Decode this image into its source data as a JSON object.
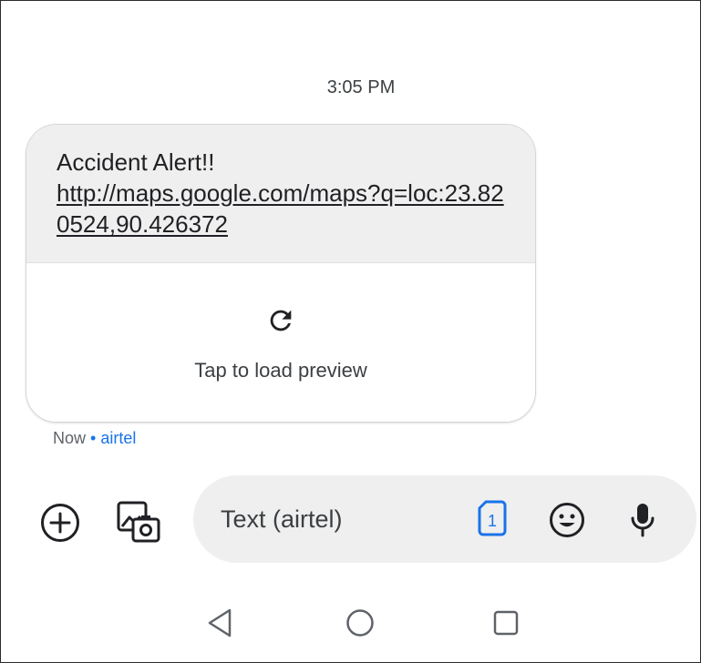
{
  "conversation": {
    "timestamp": "3:05 PM",
    "message": {
      "alert_text": "Accident Alert!!",
      "link_text": "http://maps.google.com/maps?q=loc:23.820524,90.426372",
      "preview_label": "Tap to load preview",
      "icon": "refresh-icon"
    },
    "meta": {
      "time": "Now",
      "separator": "•",
      "carrier": "airtel"
    }
  },
  "compose": {
    "placeholder": "Text (airtel)",
    "sim_slot": "1",
    "icons": [
      "add-circle-icon",
      "gallery-camera-icon",
      "sim-card-icon",
      "emoji-icon",
      "microphone-icon"
    ]
  },
  "navigation": {
    "icons": [
      "back-triangle-icon",
      "home-circle-icon",
      "recents-square-icon"
    ]
  },
  "colors": {
    "accent": "#1a73e8",
    "bubble_bg": "#efefef",
    "text": "#202124"
  }
}
